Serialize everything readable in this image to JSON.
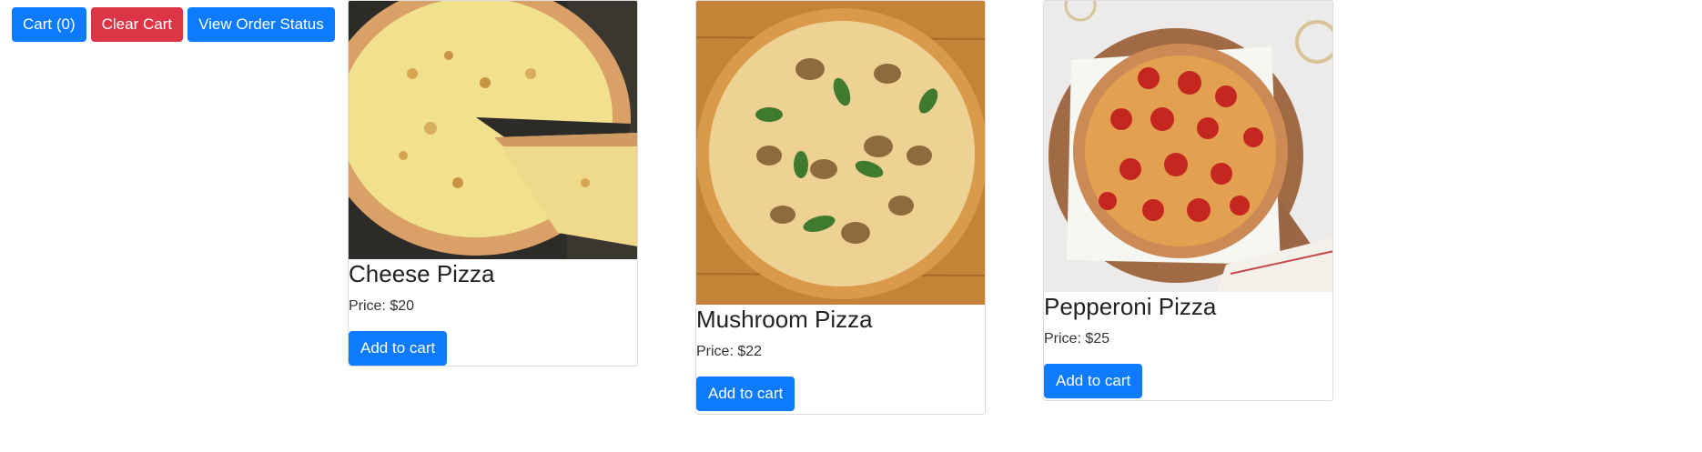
{
  "toolbar": {
    "cart_label": "Cart (0)",
    "clear_label": "Clear Cart",
    "status_label": "View Order Status"
  },
  "products": [
    {
      "name": "Cheese Pizza",
      "price": "Price: $20",
      "add_label": "Add to cart",
      "image": "cheese-pizza-photo"
    },
    {
      "name": "Mushroom Pizza",
      "price": "Price: $22",
      "add_label": "Add to cart",
      "image": "mushroom-pizza-photo"
    },
    {
      "name": "Pepperoni Pizza",
      "price": "Price: $25",
      "add_label": "Add to cart",
      "image": "pepperoni-pizza-photo"
    }
  ],
  "colors": {
    "primary": "#0d7bff",
    "danger": "#dc3545"
  }
}
